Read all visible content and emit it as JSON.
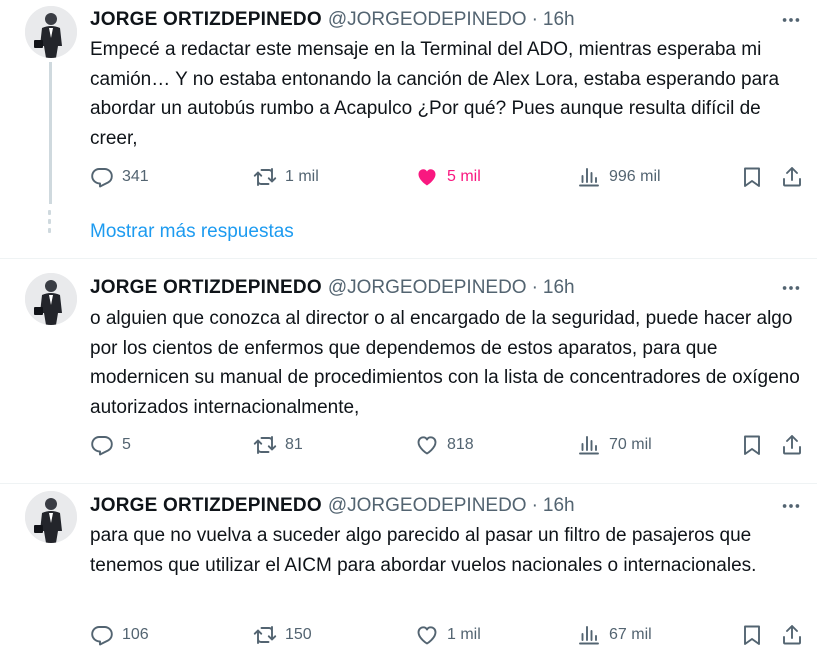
{
  "tweets": [
    {
      "name": "JORGE ORTIZDEPINEDO",
      "handle": "@JORGEODEPINEDO",
      "separator": "·",
      "time": "16h",
      "text": "Empecé a redactar este mensaje en la Terminal del ADO, mientras esperaba mi camión… Y no estaba entonando la canción de Alex Lora, estaba esperando para abordar un autobús rumbo a Acapulco ¿Por qué? Pues aunque resulta difícil de creer,",
      "replies": "341",
      "retweets": "1 mil",
      "likes": "5 mil",
      "views": "996 mil",
      "liked": true
    },
    {
      "name": "JORGE ORTIZDEPINEDO",
      "handle": "@JORGEODEPINEDO",
      "separator": "·",
      "time": "16h",
      "text": "o alguien que conozca al director o al encargado de la seguridad, puede hacer algo por los cientos de enfermos que dependemos  de estos aparatos, para que modernicen su manual de procedimientos con la  lista de concentradores de oxígeno autorizados internacionalmente,",
      "replies": "5",
      "retweets": "81",
      "likes": "818",
      "views": "70 mil",
      "liked": false
    },
    {
      "name": "JORGE ORTIZDEPINEDO",
      "handle": "@JORGEODEPINEDO",
      "separator": "·",
      "time": "16h",
      "text": "para que no vuelva a suceder algo parecido al pasar un filtro de pasajeros que tenemos que utilizar el AICM para abordar vuelos nacionales o internacionales.",
      "replies": "106",
      "retweets": "150",
      "likes": "1 mil",
      "views": "67 mil",
      "liked": false
    }
  ],
  "show_more_label": "Mostrar más respuestas",
  "colors": {
    "accent": "#1d9bf0",
    "like": "#f91880",
    "muted": "#536471",
    "text": "#0f1419"
  },
  "icons": [
    "ellipsis-icon",
    "reply-icon",
    "retweet-icon",
    "heart-icon",
    "views-icon",
    "bookmark-icon",
    "share-icon"
  ]
}
